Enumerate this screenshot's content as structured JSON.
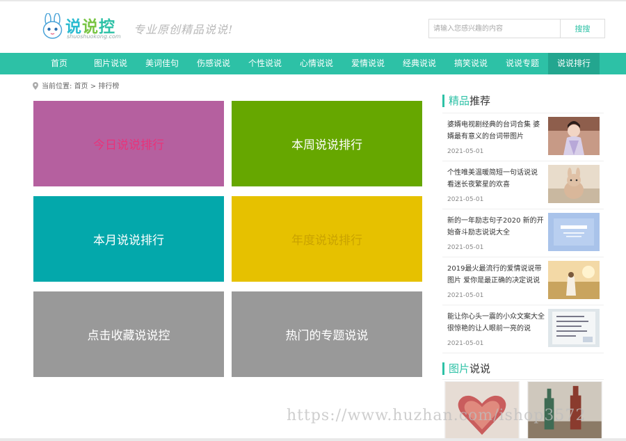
{
  "header": {
    "logo_chars": [
      "说",
      "说",
      "控"
    ],
    "logo_domain": "shuoshuokong.com",
    "slogan": "专业原创精品说说!",
    "search": {
      "placeholder": "请输入您感兴趣的内容",
      "button": "搜搜"
    }
  },
  "nav": {
    "items": [
      "首页",
      "图片说说",
      "美词佳句",
      "伤感说说",
      "个性说说",
      "心情说说",
      "爱情说说",
      "经典说说",
      "搞笑说说",
      "说说专题",
      "说说排行"
    ],
    "active_index": 10
  },
  "breadcrumb": {
    "prefix": "当前位置:",
    "home": "首页",
    "sep": ">",
    "current": "排行榜"
  },
  "tiles": [
    {
      "label": "今日说说排行",
      "bg": "#b5609f",
      "fg": "#e8337a"
    },
    {
      "label": "本周说说排行",
      "bg": "#66a700",
      "fg": "#ffffff"
    },
    {
      "label": "本月说说排行",
      "bg": "#03a8ab",
      "fg": "#ffffff"
    },
    {
      "label": "年度说说排行",
      "bg": "#e6c100",
      "fg": "#c9a200"
    },
    {
      "label": "点击收藏说说控",
      "bg": "#999999",
      "fg": "#ffffff"
    },
    {
      "label": "热门的专题说说",
      "bg": "#999999",
      "fg": "#ffffff"
    }
  ],
  "sidebar": {
    "recommend": {
      "title_hl": "精品",
      "title_rest": "推荐",
      "items": [
        {
          "title": "婆婿电视剧经典的台词合集 婆婿最有意义的台词带图片",
          "date": "2021-05-01",
          "thumb": "woman-in-hanfu"
        },
        {
          "title": "个性唯美温暖简短一句话说说 看迷长夜繁星的欢喜",
          "date": "2021-05-01",
          "thumb": "plush-rabbit"
        },
        {
          "title": "新的一年励志句子2020 新的开始奋斗励志说说大全",
          "date": "2021-05-01",
          "thumb": "blue-text-card"
        },
        {
          "title": "2019最火最流行的爱情说说带图片 爱你是最正确的决定说说",
          "date": "2021-05-01",
          "thumb": "girl-at-sunset"
        },
        {
          "title": "能让你心头一震的小众文案大全 很惊艳的让人眼前一亮的说",
          "date": "2021-05-01",
          "thumb": "handwritten-note"
        }
      ]
    },
    "pictures": {
      "title_hl": "图片",
      "title_rest": "说说"
    }
  },
  "watermark": "https://www.huzhan.com/ishop3572",
  "colors": {
    "accent": "#2dc1a6",
    "nav_active": "#23a68f"
  }
}
